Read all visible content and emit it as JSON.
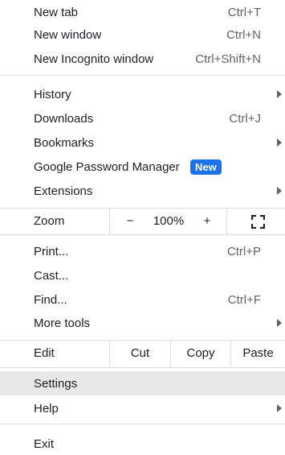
{
  "menu": {
    "new_tab": {
      "label": "New tab",
      "shortcut": "Ctrl+T"
    },
    "new_window": {
      "label": "New window",
      "shortcut": "Ctrl+N"
    },
    "new_incognito": {
      "label": "New Incognito window",
      "shortcut": "Ctrl+Shift+N"
    },
    "history": {
      "label": "History"
    },
    "downloads": {
      "label": "Downloads",
      "shortcut": "Ctrl+J"
    },
    "bookmarks": {
      "label": "Bookmarks"
    },
    "password_manager": {
      "label": "Google Password Manager",
      "badge": "New"
    },
    "extensions": {
      "label": "Extensions"
    },
    "zoom": {
      "label": "Zoom",
      "minus": "−",
      "value": "100%",
      "plus": "+",
      "fullscreen_icon": "fullscreen-icon"
    },
    "print": {
      "label": "Print...",
      "shortcut": "Ctrl+P"
    },
    "cast": {
      "label": "Cast..."
    },
    "find": {
      "label": "Find...",
      "shortcut": "Ctrl+F"
    },
    "more_tools": {
      "label": "More tools"
    },
    "edit": {
      "label": "Edit",
      "cut": "Cut",
      "copy": "Copy",
      "paste": "Paste"
    },
    "settings": {
      "label": "Settings"
    },
    "help": {
      "label": "Help"
    },
    "exit": {
      "label": "Exit"
    }
  },
  "colors": {
    "badge_bg": "#1a73e8",
    "highlight_bg": "#e8e8e8",
    "divider": "#dadce0"
  }
}
